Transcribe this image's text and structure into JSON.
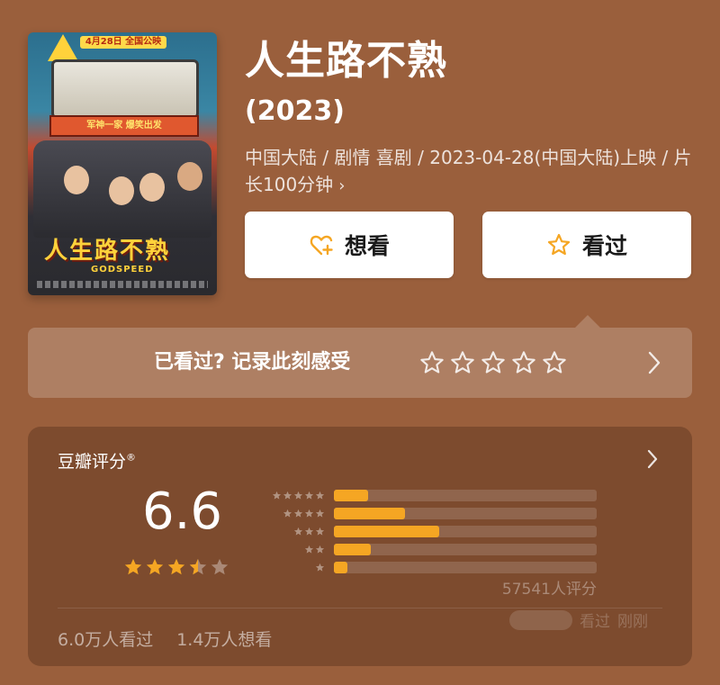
{
  "poster": {
    "release_banner": "4月28日 全国公映",
    "strip_text": "军神一家 爆笑出发",
    "title_art": "人生路不熟",
    "subtitle_art": "GODSPEED"
  },
  "movie": {
    "title": "人生路不熟",
    "year": "(2023)",
    "meta_line": "中国大陆 / 剧情 喜剧 / 2023-04-28(中国大陆)上映 / 片长100分钟",
    "meta_arrow": "›"
  },
  "actions": {
    "want_label": "想看",
    "seen_label": "看过"
  },
  "record": {
    "label": "已看过? 记录此刻感受",
    "star_count": 5
  },
  "rating": {
    "source_label": "豆瓣评分",
    "source_mark": "®",
    "score": "6.6",
    "star_value": 3.5,
    "distribution": [
      {
        "stars": 5,
        "fraction": 0.13
      },
      {
        "stars": 4,
        "fraction": 0.27
      },
      {
        "stars": 3,
        "fraction": 0.4
      },
      {
        "stars": 2,
        "fraction": 0.14
      },
      {
        "stars": 1,
        "fraction": 0.05
      }
    ],
    "count_text": "57541人评分",
    "seen_count": "6.0万人看过",
    "want_count": "1.4万人想看",
    "watermark_text": "看过",
    "watermark_suffix": "刚刚"
  },
  "colors": {
    "background": "#9a5f3c",
    "accent": "#f5a623",
    "button_bg": "#ffffff"
  }
}
